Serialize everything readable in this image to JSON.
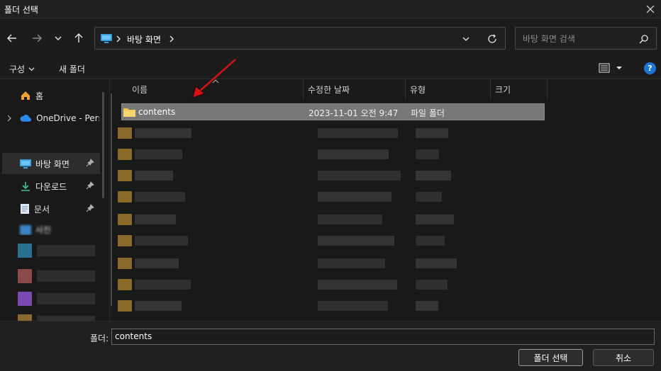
{
  "window": {
    "title": "폴더 선택"
  },
  "nav": {
    "breadcrumb": [
      "바탕 화면"
    ],
    "search_placeholder": "바탕 화면 검색"
  },
  "commands": {
    "organize": "구성",
    "new_folder": "새 폴더"
  },
  "sidebar": {
    "items": [
      {
        "label": "홈",
        "icon": "home-icon"
      },
      {
        "label": "OneDrive - Pers",
        "icon": "cloud-icon"
      },
      {
        "label": "바탕 화면",
        "icon": "desktop-icon",
        "pinned": true,
        "selected": true
      },
      {
        "label": "다운로드",
        "icon": "download-icon",
        "pinned": true
      },
      {
        "label": "문서",
        "icon": "document-icon",
        "pinned": true
      },
      {
        "label": "사진",
        "icon": "pictures-icon",
        "pinned": true
      }
    ]
  },
  "columns": [
    "이름",
    "수정한 날짜",
    "유형",
    "크기"
  ],
  "rows": [
    {
      "name": "contents",
      "modified": "2023-11-01 오전 9:47",
      "type": "파일 폴더",
      "size": ""
    }
  ],
  "bottom": {
    "folder_label": "폴더:",
    "folder_value": "contents",
    "select_button": "폴더 선택",
    "cancel_button": "취소"
  },
  "colors": {
    "accent": "#4cc2ff",
    "folder": "#f3c547",
    "help": "#1a78d4",
    "arrow": "#d81212"
  }
}
